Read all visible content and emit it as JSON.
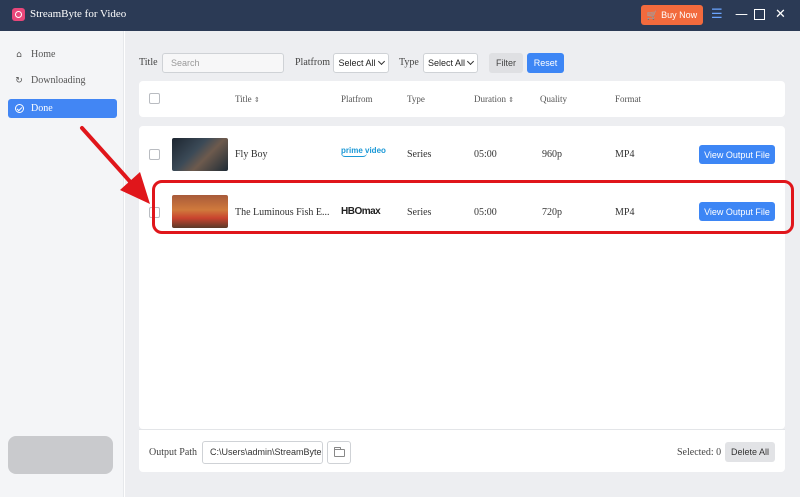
{
  "app": {
    "title": "StreamByte for Video",
    "buy_label": "Buy Now"
  },
  "sidebar": {
    "items": [
      {
        "label": "Home",
        "icon": "home-icon"
      },
      {
        "label": "Downloading",
        "icon": "download-icon"
      },
      {
        "label": "Done",
        "icon": "check-circle-icon"
      }
    ],
    "active": "Done"
  },
  "filters": {
    "title_label": "Title",
    "search_placeholder": "Search",
    "platform_label": "Platfrom",
    "platform_value": "Select All",
    "type_label": "Type",
    "type_value": "Select All",
    "filter_label": "Filter",
    "reset_label": "Reset"
  },
  "table": {
    "columns": [
      "Title",
      "Platfrom",
      "Type",
      "Duration",
      "Quality",
      "Format"
    ],
    "rows": [
      {
        "title": "Fly Boy",
        "platform": "prime video",
        "type": "Series",
        "duration": "05:00",
        "quality": "960p",
        "format": "MP4",
        "action": "View Output File"
      },
      {
        "title": "The Luminous Fish E...",
        "platform": "HBOmax",
        "type": "Series",
        "duration": "05:00",
        "quality": "720p",
        "format": "MP4",
        "action": "View Output File"
      }
    ]
  },
  "footer": {
    "output_label": "Output Path",
    "output_path": "C:\\Users\\admin\\StreamByte",
    "selected_text": "Selected: 0",
    "delete_label": "Delete All"
  },
  "colors": {
    "titlebar": "#2b3a55",
    "accent": "#3d86f5",
    "buy": "#f26a3d",
    "highlight": "#e0161b"
  }
}
